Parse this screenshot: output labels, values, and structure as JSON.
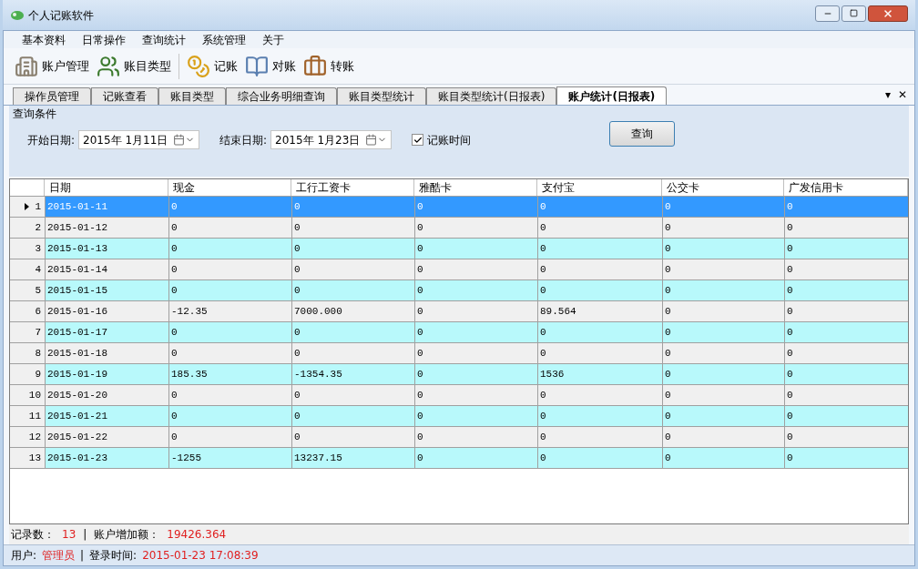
{
  "window": {
    "title": "个人记账软件"
  },
  "menu": [
    "基本资料",
    "日常操作",
    "查询统计",
    "系统管理",
    "关于"
  ],
  "toolbar": [
    {
      "kind": "building",
      "label": "账户管理"
    },
    {
      "kind": "people",
      "label": "账目类型"
    },
    {
      "kind": "coins",
      "label": "记账"
    },
    {
      "kind": "book",
      "label": "对账"
    },
    {
      "kind": "briefcase",
      "label": "转账"
    }
  ],
  "tabs": [
    {
      "label": "操作员管理",
      "selected": false
    },
    {
      "label": "记账查看",
      "selected": false
    },
    {
      "label": "账目类型",
      "selected": false
    },
    {
      "label": "综合业务明细查询",
      "selected": false
    },
    {
      "label": "账目类型统计",
      "selected": false
    },
    {
      "label": "账目类型统计(日报表)",
      "selected": false
    },
    {
      "label": "账户统计(日报表)",
      "selected": true
    }
  ],
  "tab_controls": {
    "dropdown": "▾",
    "close": "✕"
  },
  "query": {
    "group_title": "查询条件",
    "start_label": "开始日期:",
    "start_value": "2015年  1月11日",
    "end_label": "结束日期:",
    "end_value": "2015年  1月23日",
    "checkbox": {
      "label": "记账时间",
      "checked": true
    },
    "button": "查询"
  },
  "table": {
    "columns": [
      "日期",
      "现金",
      "工行工资卡",
      "雅酷卡",
      "支付宝",
      "公交卡",
      "广发信用卡"
    ],
    "rows": [
      {
        "number": "1",
        "selected": true,
        "cells": [
          "2015-01-11",
          "0",
          "0",
          "0",
          "0",
          "0",
          "0"
        ]
      },
      {
        "number": "2",
        "selected": false,
        "cells": [
          "2015-01-12",
          "0",
          "0",
          "0",
          "0",
          "0",
          "0"
        ]
      },
      {
        "number": "3",
        "selected": false,
        "cells": [
          "2015-01-13",
          "0",
          "0",
          "0",
          "0",
          "0",
          "0"
        ]
      },
      {
        "number": "4",
        "selected": false,
        "cells": [
          "2015-01-14",
          "0",
          "0",
          "0",
          "0",
          "0",
          "0"
        ]
      },
      {
        "number": "5",
        "selected": false,
        "cells": [
          "2015-01-15",
          "0",
          "0",
          "0",
          "0",
          "0",
          "0"
        ]
      },
      {
        "number": "6",
        "selected": false,
        "cells": [
          "2015-01-16",
          "-12.35",
          "7000.000",
          "0",
          "89.564",
          "0",
          "0"
        ]
      },
      {
        "number": "7",
        "selected": false,
        "cells": [
          "2015-01-17",
          "0",
          "0",
          "0",
          "0",
          "0",
          "0"
        ]
      },
      {
        "number": "8",
        "selected": false,
        "cells": [
          "2015-01-18",
          "0",
          "0",
          "0",
          "0",
          "0",
          "0"
        ]
      },
      {
        "number": "9",
        "selected": false,
        "cells": [
          "2015-01-19",
          "185.35",
          "-1354.35",
          "0",
          "1536",
          "0",
          "0"
        ]
      },
      {
        "number": "10",
        "selected": false,
        "cells": [
          "2015-01-20",
          "0",
          "0",
          "0",
          "0",
          "0",
          "0"
        ]
      },
      {
        "number": "11",
        "selected": false,
        "cells": [
          "2015-01-21",
          "0",
          "0",
          "0",
          "0",
          "0",
          "0"
        ]
      },
      {
        "number": "12",
        "selected": false,
        "cells": [
          "2015-01-22",
          "0",
          "0",
          "0",
          "0",
          "0",
          "0"
        ]
      },
      {
        "number": "13",
        "selected": false,
        "cells": [
          "2015-01-23",
          "-1255",
          "13237.15",
          "0",
          "0",
          "0",
          "0"
        ]
      }
    ]
  },
  "summary": {
    "count_label": "记录数：",
    "count": "13",
    "separator": "|",
    "total_label": "账户增加额：",
    "total": "19426.364"
  },
  "status_bar": {
    "user_label": "用户:",
    "user": "管理员",
    "separator": "|",
    "login_label": "登录时间:",
    "login_time": "2015-01-23 17:08:39"
  }
}
